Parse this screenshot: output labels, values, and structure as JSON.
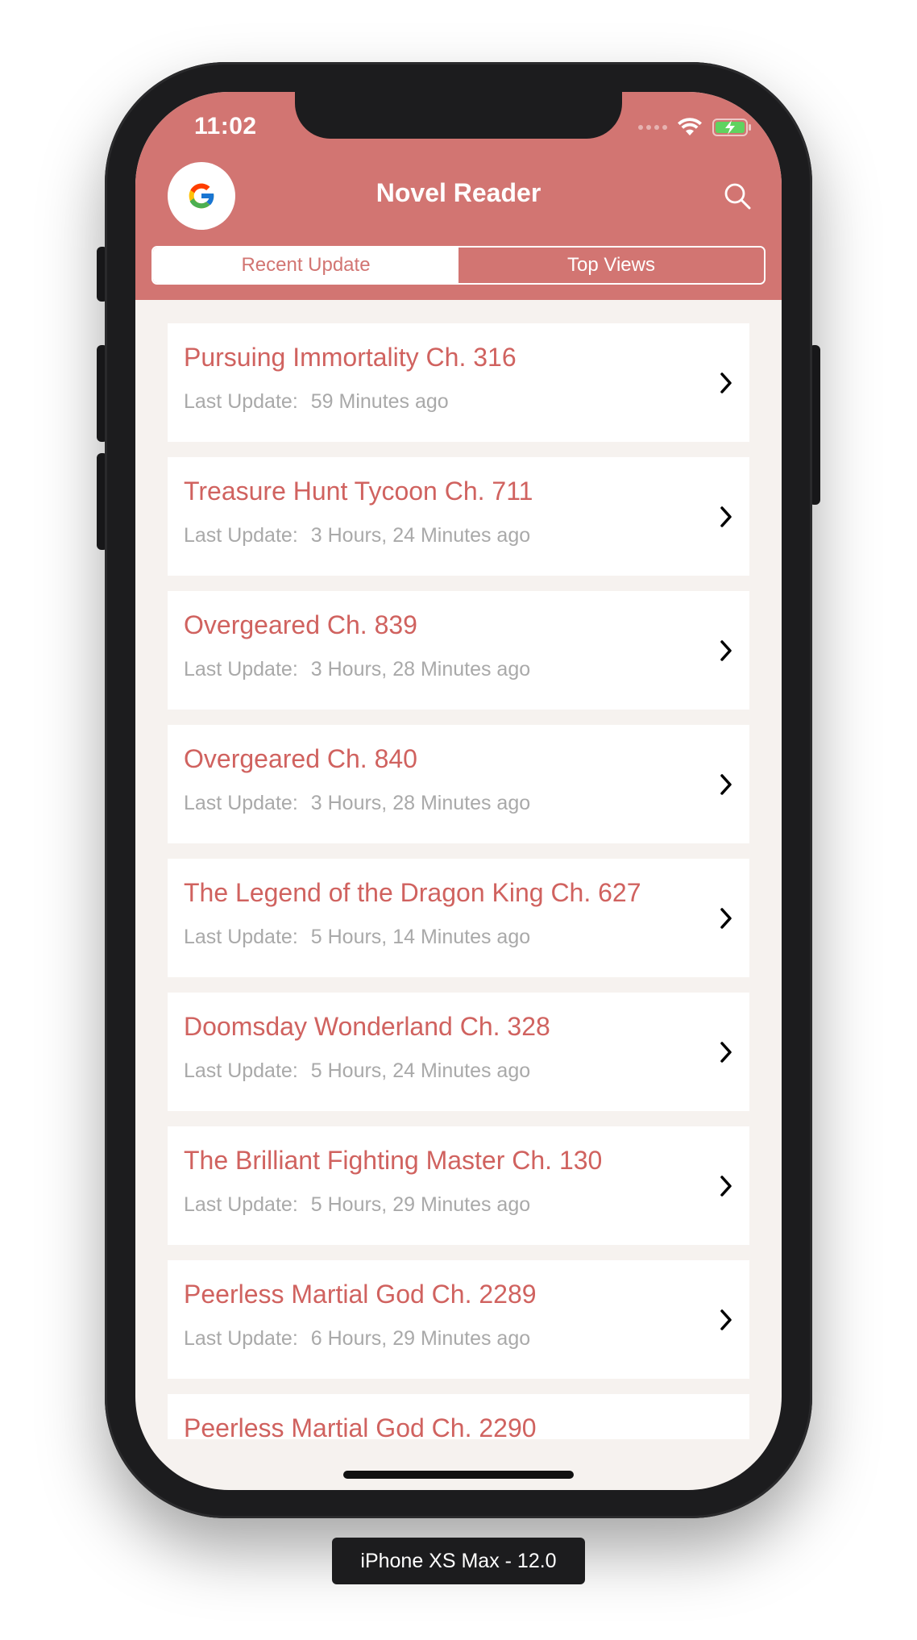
{
  "status_bar": {
    "time": "11:02"
  },
  "header": {
    "title": "Novel Reader",
    "left_icon": "google-icon",
    "right_icon": "search-icon",
    "background_color": "#d27572"
  },
  "tabs": [
    {
      "label": "Recent Update",
      "active": true
    },
    {
      "label": "Top Views",
      "active": false
    }
  ],
  "list": {
    "items": [
      {
        "title": "Pursuing Immortality Ch. 316",
        "prefix": "Last Update:",
        "time": "59 Minutes ago"
      },
      {
        "title": "Treasure Hunt Tycoon Ch. 711",
        "prefix": "Last Update:",
        "time": "3 Hours, 24 Minutes ago"
      },
      {
        "title": "Overgeared Ch. 839",
        "prefix": "Last Update:",
        "time": "3 Hours, 28 Minutes ago"
      },
      {
        "title": "Overgeared Ch. 840",
        "prefix": "Last Update:",
        "time": "3 Hours, 28 Minutes ago"
      },
      {
        "title": "The Legend of the Dragon King Ch. 627",
        "prefix": "Last Update:",
        "time": "5 Hours, 14 Minutes ago"
      },
      {
        "title": "Doomsday Wonderland Ch. 328",
        "prefix": "Last Update:",
        "time": "5 Hours, 24 Minutes ago"
      },
      {
        "title": "The Brilliant Fighting Master Ch. 130",
        "prefix": "Last Update:",
        "time": "5 Hours, 29 Minutes ago"
      },
      {
        "title": "Peerless Martial God Ch. 2289",
        "prefix": "Last Update:",
        "time": "6 Hours, 29 Minutes ago"
      },
      {
        "title": "Peerless Martial God Ch. 2290",
        "prefix": "",
        "time": ""
      }
    ],
    "chevron_icon": "chevron-right-icon",
    "title_color": "#d0625f"
  },
  "device_label": "iPhone XS Max - 12.0"
}
